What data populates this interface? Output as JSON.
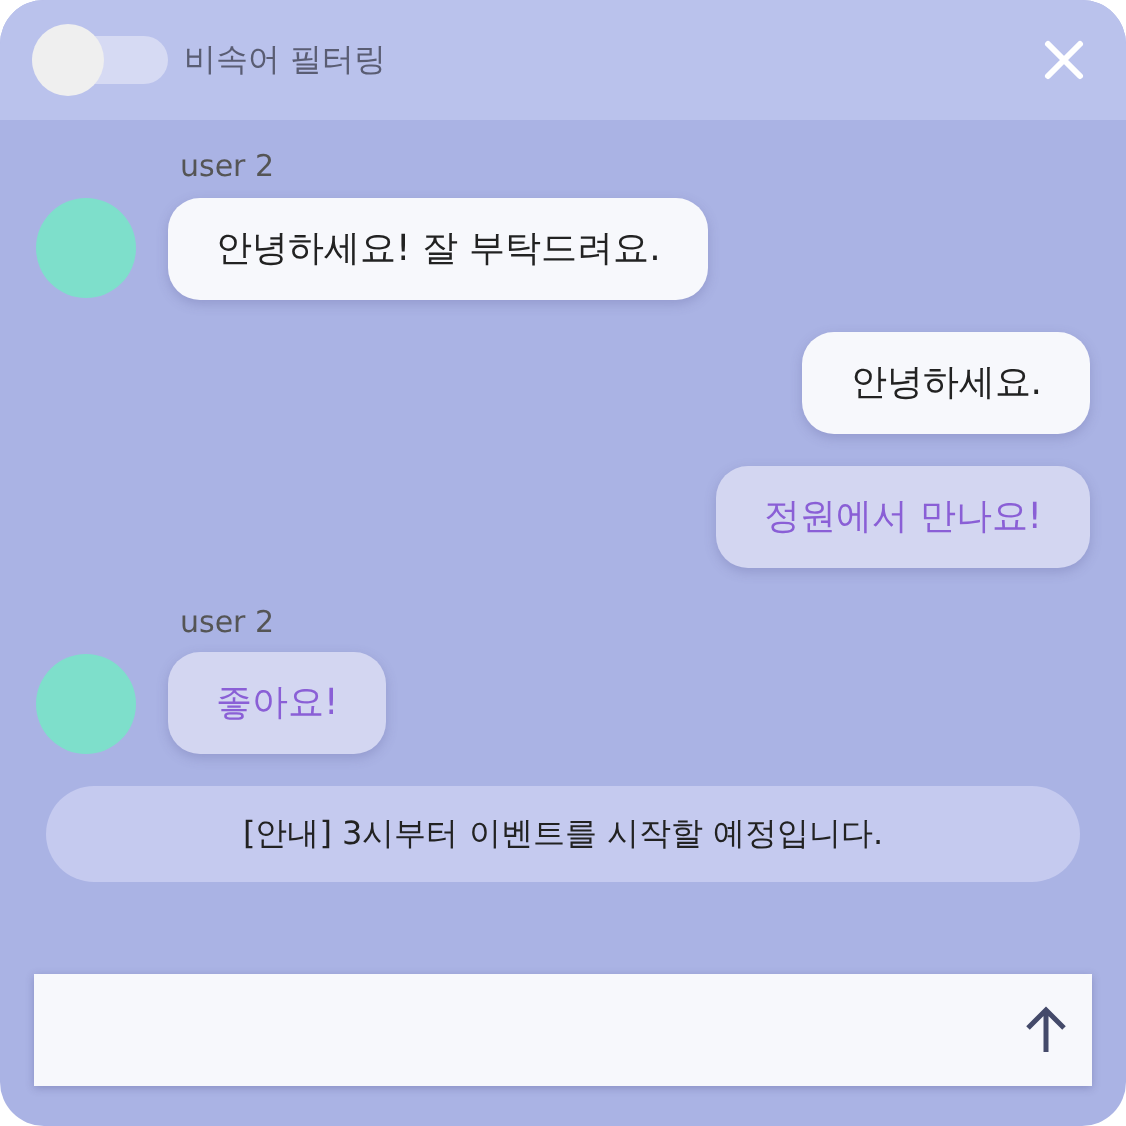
{
  "header": {
    "filter_toggle": {
      "label": "비속어 필터링",
      "on": false
    }
  },
  "messages": [
    {
      "kind": "received",
      "sender": "user 2",
      "text": "안녕하세요! 잘 부탁드려요.",
      "highlighted": false
    },
    {
      "kind": "sent",
      "text": "안녕하세요.",
      "highlighted": false
    },
    {
      "kind": "sent",
      "text": "정원에서 만나요!",
      "highlighted": true
    },
    {
      "kind": "received",
      "sender": "user 2",
      "text": "좋아요!",
      "highlighted": true
    },
    {
      "kind": "notice",
      "text": "[안내] 3시부터 이벤트를 시작할 예정입니다."
    }
  ]
}
